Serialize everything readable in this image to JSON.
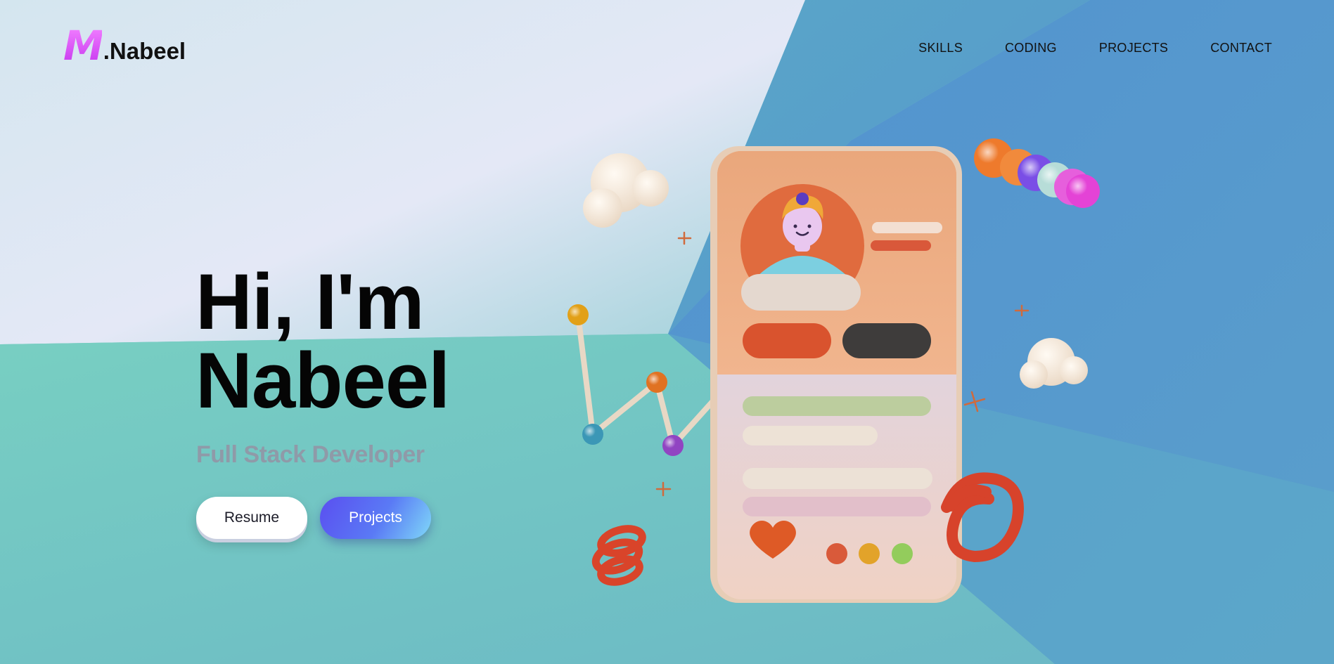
{
  "header": {
    "logo_mark": "M",
    "logo_text": ".Nabeel",
    "nav": [
      {
        "label": "SKILLS"
      },
      {
        "label": "CODING"
      },
      {
        "label": "PROJECTS"
      },
      {
        "label": "CONTACT"
      }
    ]
  },
  "hero": {
    "title_line1": "Hi, I'm",
    "title_line2": "Nabeel",
    "subtitle": "Full Stack Developer",
    "buttons": {
      "resume": "Resume",
      "projects": "Projects"
    }
  },
  "colors": {
    "accent_logo": "#e05cf5",
    "button_projects": "#5a5df2",
    "bg_teal": "#74c6c0",
    "bg_blue": "#5591cc"
  }
}
